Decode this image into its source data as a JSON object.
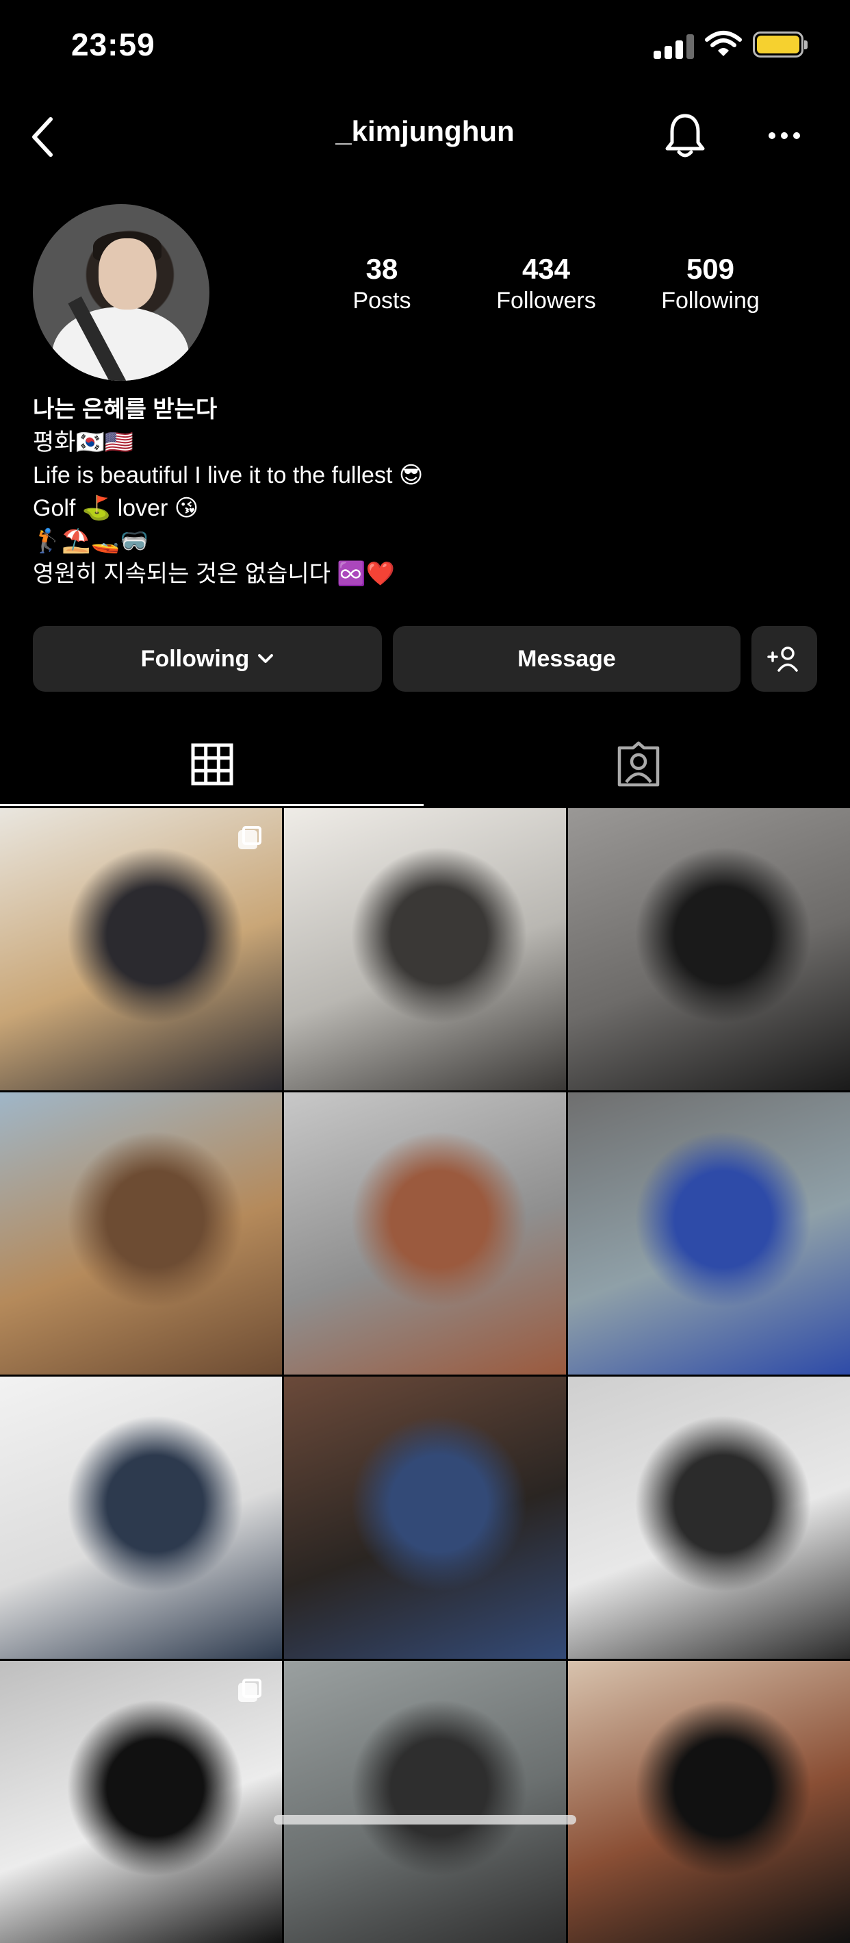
{
  "status_bar": {
    "time": "23:59"
  },
  "header": {
    "username": "_kimjunghun"
  },
  "stats": [
    {
      "value": "38",
      "label": "Posts"
    },
    {
      "value": "434",
      "label": "Followers"
    },
    {
      "value": "509",
      "label": "Following"
    }
  ],
  "bio": {
    "lines": [
      "나는 은혜를 받는다",
      "평화🇰🇷🇺🇸",
      "Life is beautiful I live it to the fullest 😎",
      "Golf ⛳ lover 😘",
      "🏌️⛱️🚤🥽",
      "영원히 지속되는 것은 없습니다 ♾️❤️"
    ]
  },
  "buttons": {
    "following": "Following",
    "message": "Message"
  },
  "icons": {
    "back": "chevron-left-icon",
    "notifications": "bell-icon",
    "more": "more-horizontal-icon",
    "add_person": "add-person-icon",
    "grid_tab": "grid-icon",
    "tagged_tab": "tagged-person-icon"
  },
  "grid": {
    "tiles": [
      {
        "colors": [
          "#c9a677",
          "#2b2a2f",
          "#e9e6df"
        ],
        "multi": true
      },
      {
        "colors": [
          "#b9b7b2",
          "#3a3836",
          "#efece7"
        ],
        "multi": false
      },
      {
        "colors": [
          "#6d6b69",
          "#1a1a1a",
          "#9a9896"
        ],
        "multi": false
      },
      {
        "colors": [
          "#b58a5b",
          "#6d4c33",
          "#9fb6c8"
        ],
        "multi": false
      },
      {
        "colors": [
          "#8f8f8f",
          "#9b5a3e",
          "#c8c8c8"
        ],
        "multi": false
      },
      {
        "colors": [
          "#8fa0a8",
          "#2e4ba8",
          "#6f6f6f"
        ],
        "multi": false
      },
      {
        "colors": [
          "#dcdcdc",
          "#2d3a4e",
          "#f2f2f2"
        ],
        "multi": false
      },
      {
        "colors": [
          "#2a2522",
          "#334a77",
          "#6b4a3a"
        ],
        "multi": false
      },
      {
        "colors": [
          "#e8e8e8",
          "#2b2b2b",
          "#cfcfcf"
        ],
        "multi": false
      },
      {
        "colors": [
          "#ececec",
          "#111111",
          "#bfbfbf"
        ],
        "multi": true
      },
      {
        "colors": [
          "#6b7070",
          "#2e2e2e",
          "#9aa0a0"
        ],
        "multi": false
      },
      {
        "colors": [
          "#8a4f35",
          "#111111",
          "#d8c3ae"
        ],
        "multi": false
      }
    ]
  }
}
